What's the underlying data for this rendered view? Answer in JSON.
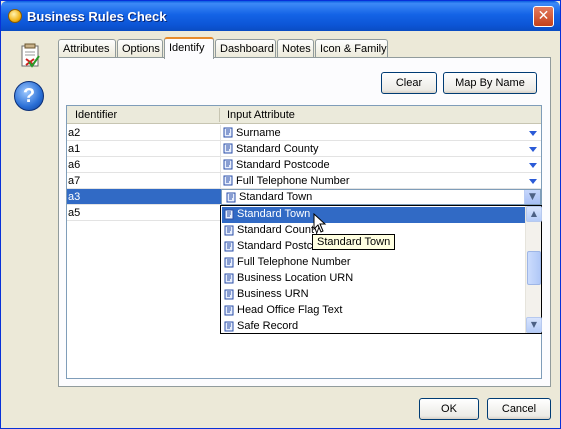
{
  "window": {
    "title": "Business Rules Check"
  },
  "tabs": [
    {
      "label": "Attributes"
    },
    {
      "label": "Options"
    },
    {
      "label": "Identify"
    },
    {
      "label": "Dashboard"
    },
    {
      "label": "Notes"
    },
    {
      "label": "Icon & Family"
    }
  ],
  "active_tab": "Identify",
  "toolbar": {
    "clear_label": "Clear",
    "map_by_name_label": "Map By Name"
  },
  "table": {
    "headers": [
      "Identifier",
      "Input Attribute"
    ],
    "rows": [
      {
        "id": "a2",
        "attribute": "Surname"
      },
      {
        "id": "a1",
        "attribute": "Standard County"
      },
      {
        "id": "a6",
        "attribute": "Standard Postcode"
      },
      {
        "id": "a7",
        "attribute": "Full Telephone Number"
      },
      {
        "id": "a3",
        "attribute": "Standard Town"
      },
      {
        "id": "a5",
        "attribute": ""
      }
    ]
  },
  "dropdown": {
    "items": [
      "Standard Town",
      "Standard County",
      "Standard Postcode",
      "Full Telephone Number",
      "Business Location URN",
      "Business URN",
      "Head Office Flag Text",
      "Safe Record"
    ],
    "tooltip": "Standard Town"
  },
  "footer": {
    "ok_label": "OK",
    "cancel_label": "Cancel"
  },
  "colors": {
    "selection": "#316ac5",
    "titlebar": "#0a5ee0",
    "active_tab_accent": "#e68b2c"
  }
}
